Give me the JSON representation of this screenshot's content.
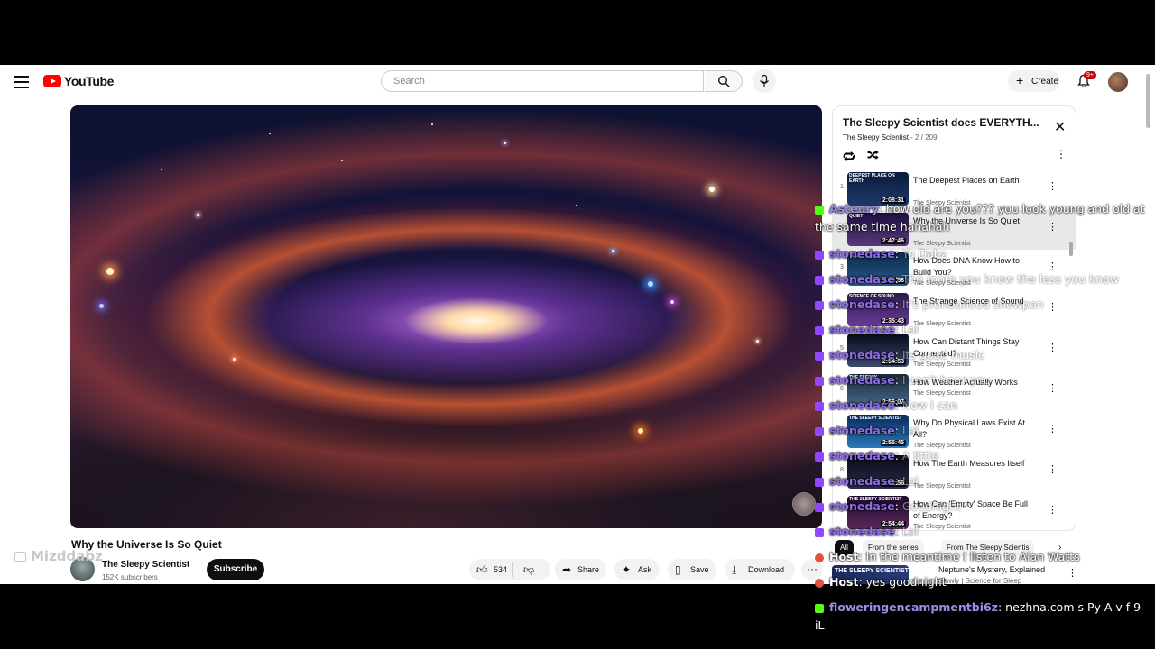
{
  "header": {
    "logo_text": "YouTube",
    "search_placeholder": "Search",
    "create_label": "Create",
    "notification_count": "9+"
  },
  "video": {
    "title": "Why the Universe Is So Quiet",
    "channel": "The Sleepy Scientist",
    "subscribers": "152K subscribers",
    "subscribe_label": "Subscribe",
    "likes": "534",
    "share_label": "Share",
    "ask_label": "Ask",
    "save_label": "Save",
    "download_label": "Download"
  },
  "playlist": {
    "title": "The Sleepy Scientist does EVERYTH...",
    "owner": "The Sleepy Scientist",
    "position": "- 2 / 209",
    "items": [
      {
        "index": "1",
        "title": "The Deepest Places on Earth",
        "channel": "The Sleepy Scientist",
        "duration": "2:08:31",
        "thumb_text": "DEEPEST PLACE ON EARTH"
      },
      {
        "index": "",
        "title": "Why the Universe Is So Quiet",
        "channel": "The Sleepy Scientist",
        "duration": "2:47:46",
        "thumb_text": "QUIET"
      },
      {
        "index": "3",
        "title": "How Does DNA Know How to Build You?",
        "channel": "The Sleepy Scientist",
        "duration": "2:49:58",
        "thumb_text": "YOU"
      },
      {
        "index": "4",
        "title": "The Strange Science of Sound",
        "channel": "The Sleepy Scientist",
        "duration": "2:35:43",
        "thumb_text": "SCIENCE OF SOUND"
      },
      {
        "index": "5",
        "title": "How Can Distant Things Stay Connected?",
        "channel": "The Sleepy Scientist",
        "duration": "2:54:53",
        "thumb_text": ""
      },
      {
        "index": "6",
        "title": "How Weather Actually Works",
        "channel": "The Sleepy Scientist",
        "duration": "2:56:07",
        "thumb_text": "THE SLEEPY"
      },
      {
        "index": "7",
        "title": "Why Do Physical Laws Exist At All?",
        "channel": "The Sleepy Scientist",
        "duration": "2:55:45",
        "thumb_text": "THE SLEEPY SCIENTIST"
      },
      {
        "index": "8",
        "title": "How The Earth Measures Itself",
        "channel": "The Sleepy Scientist",
        "duration": "3:02:56",
        "thumb_text": ""
      },
      {
        "index": "9",
        "title": "How Can 'Empty' Space Be Full of Energy?",
        "channel": "The Sleepy Scientist",
        "duration": "2:54:44",
        "thumb_text": "THE SLEEPY SCIENTIST"
      }
    ]
  },
  "chips": [
    "All",
    "From the series",
    "From The Sleepy Scientis"
  ],
  "recommendation": {
    "thumb_text": "THE SLEEPY SCIENTIST",
    "title": "Neptune's Mystery, Explained",
    "channel": "Slowly | Science for Sleep"
  },
  "overlay": {
    "watermark": "Mizddabz",
    "chat": [
      {
        "platform": "kick",
        "user": "Asteury",
        "text": "how old are you??? you look young and old at the same time hahahah"
      },
      {
        "platform": "twitch",
        "user": "stonedase",
        "text": "Yo Dabz"
      },
      {
        "platform": "twitch",
        "user": "stonedase",
        "text": "The more you know the less you know"
      },
      {
        "platform": "twitch",
        "user": "stonedase",
        "text": "It's pronounced showpen"
      },
      {
        "platform": "twitch",
        "user": "stonedase",
        "text": "Lol"
      },
      {
        "platform": "twitch",
        "user": "stonedase",
        "text": "Its good music"
      },
      {
        "platform": "twitch",
        "user": "stonedase",
        "text": "I can't hear you"
      },
      {
        "platform": "twitch",
        "user": "stonedase",
        "text": "Now i can"
      },
      {
        "platform": "twitch",
        "user": "stonedase",
        "text": "Lol"
      },
      {
        "platform": "twitch",
        "user": "stonedase",
        "text": "A little"
      },
      {
        "platform": "twitch",
        "user": "stonedase",
        "text": "Lol"
      },
      {
        "platform": "twitch",
        "user": "stonedase",
        "text": "Goodnight"
      },
      {
        "platform": "twitch",
        "user": "stonedase",
        "text": "Lol"
      },
      {
        "platform": "host",
        "user": "Host",
        "text": "In the meantime I listen to Alan Watts"
      },
      {
        "platform": "host",
        "user": "Host",
        "text": "yes goodnight"
      },
      {
        "platform": "kick",
        "user": "floweringencampmentbi6z",
        "text": "nezhna.com s Py A v f 9 iL"
      }
    ]
  },
  "colors": {
    "brand_red": "#ff0000",
    "twitch": "#9146ff",
    "kick": "#53fc18"
  }
}
